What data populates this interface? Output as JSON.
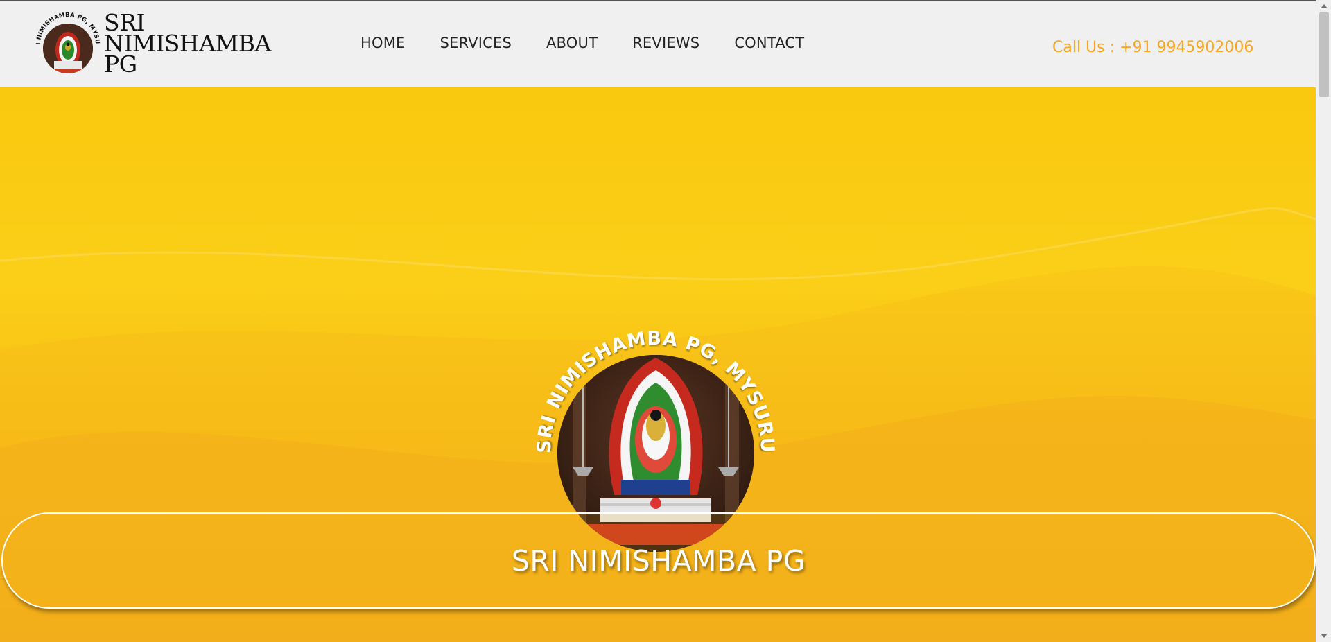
{
  "header": {
    "logo_icon": "temple-deity-emblem",
    "logo_ring_text": "SRI NIMISHAMBA PG, MYSURU",
    "title_lines": [
      "SRI",
      "NIMISHAMBA",
      "PG"
    ],
    "nav": [
      {
        "label": "HOME"
      },
      {
        "label": "SERVICES"
      },
      {
        "label": "ABOUT"
      },
      {
        "label": "REVIEWS"
      },
      {
        "label": "CONTACT"
      }
    ],
    "call_text": "Call Us : +91 9945902006"
  },
  "hero": {
    "emblem_icon": "temple-deity-emblem",
    "emblem_ring_text": "SRI NIMISHAMBA PG, MYSURU",
    "banner_text": "SRI NIMISHAMBA PG"
  },
  "colors": {
    "accent": "#f5a623",
    "hero_yellow": "#f9c80f",
    "header_bg": "#f0f0f0"
  }
}
